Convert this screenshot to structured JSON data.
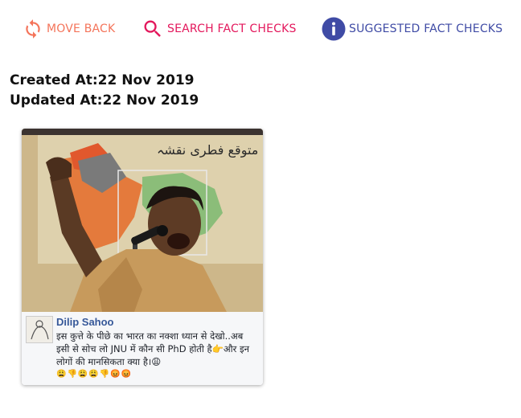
{
  "toolbar": {
    "move_back_label": "MOVE BACK",
    "move_back_icon": "refresh-arrows-icon",
    "search_label": "SEARCH FACT CHECKS",
    "search_icon": "search-icon",
    "suggested_label": "SUGGESTED FACT CHECKS",
    "suggested_icon": "info-icon",
    "colors": {
      "move_back": "#f4745a",
      "search": "#e3185c",
      "suggested": "#3f4ba5"
    }
  },
  "meta": {
    "created": "Created At:22 Nov 2019",
    "updated": "Updated At:22 Nov 2019"
  },
  "card": {
    "map_text": "کا متوقع فطری نقشہ",
    "post_author": "Dilip Sahoo",
    "post_text": "इस कुत्ते के पीछे का भारत का नक्शा ध्यान से देखो..अब इसी से सोच लो JNU में कौन सी PhD होती है👉और इन लोगों की मानसिकता क्या है।😩",
    "post_emojis": "😩👎😩😩👎😡😡"
  }
}
